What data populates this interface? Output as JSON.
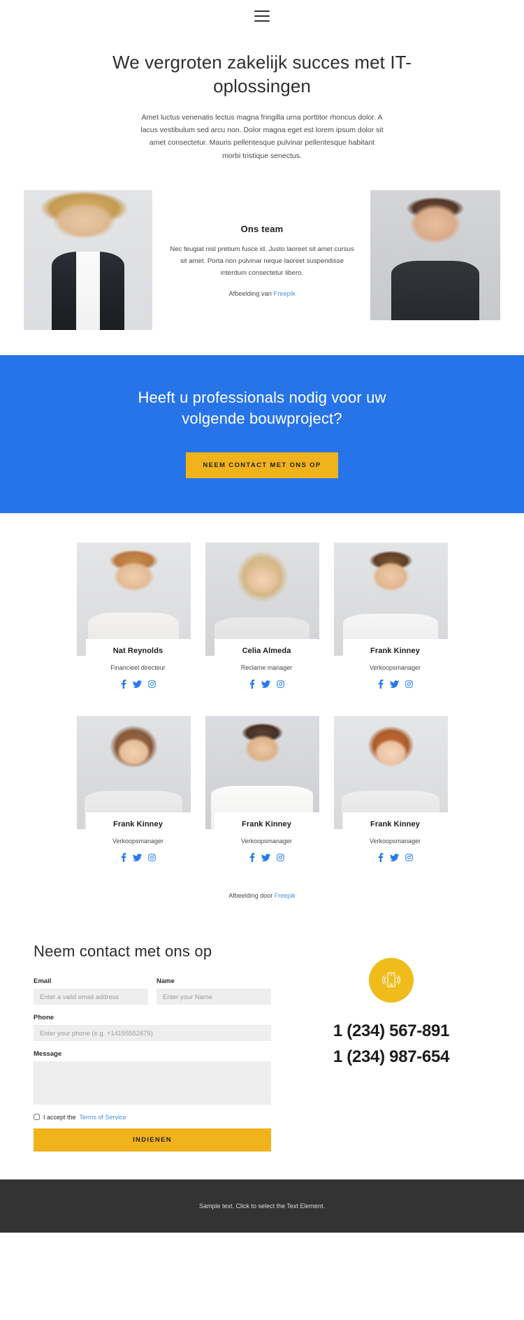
{
  "header": {
    "menu_icon": "hamburger-menu-icon"
  },
  "hero": {
    "title": "We vergroten zakelijk succes met IT-oplossingen",
    "description": "Amet luctus venenatis lectus magna fringilla urna porttitor rhoncus dolor. A lacus vestibulum sed arcu non. Dolor magna eget est lorem ipsum dolor sit amet consectetur. Mauris pellentesque pulvinar pellentesque habitant morbi tristique senectus."
  },
  "team_intro": {
    "heading": "Ons team",
    "body": "Nec feugiat nisl pretium fusce id. Justo laoreet sit amet cursus sit amet. Porta non pulvinar neque laoreet suspendisse interdum consectetur libero.",
    "credit_prefix": "Afbeelding van ",
    "credit_link": "Freepik",
    "photo_left_alt": "blonde-businesswoman-photo",
    "photo_right_alt": "young-man-black-shirt-photo"
  },
  "cta": {
    "heading": "Heeft u professionals nodig voor uw volgende bouwproject?",
    "button": "NEEM CONTACT MET ONS OP",
    "bg_color": "#2774e8",
    "button_color": "#f0b31b"
  },
  "team": {
    "members": [
      {
        "name": "Nat Reynolds",
        "role": "Financieel directeur",
        "photo": "bearded-man-glasses-photo"
      },
      {
        "name": "Celia Almeda",
        "role": "Reclame manager",
        "photo": "blonde-woman-photo"
      },
      {
        "name": "Frank Kinney",
        "role": "Verkoopsmanager",
        "photo": "young-man-white-shirt-photo"
      },
      {
        "name": "Frank Kinney",
        "role": "Verkoopsmanager",
        "photo": "woman-bob-haircut-photo"
      },
      {
        "name": "Frank Kinney",
        "role": "Verkoopsmanager",
        "photo": "bearded-man-white-shirt-photo"
      },
      {
        "name": "Frank Kinney",
        "role": "Verkoopsmanager",
        "photo": "redhead-woman-photo"
      }
    ],
    "social_icons": [
      "facebook-icon",
      "twitter-icon",
      "instagram-icon"
    ],
    "credit_prefix": "Afbeelding door ",
    "credit_link": "Freepik"
  },
  "contact": {
    "heading": "Neem contact met ons op",
    "fields": {
      "email": {
        "label": "Email",
        "placeholder": "Enter a valid email address",
        "value": ""
      },
      "name": {
        "label": "Name",
        "placeholder": "Enter your Name",
        "value": ""
      },
      "phone": {
        "label": "Phone",
        "placeholder": "Enter your phone (e.g. +14155552675)",
        "value": ""
      },
      "message": {
        "label": "Message",
        "placeholder": "",
        "value": ""
      }
    },
    "accept_prefix": "I accept the ",
    "accept_link": "Terms of Service",
    "submit": "INDIENEN",
    "phone_icon": "mobile-phone-ringing-icon",
    "phone_numbers": [
      "1 (234) 567-891",
      "1 (234) 987-654"
    ]
  },
  "footer": {
    "text": "Sample text. Click to select the Text Element."
  }
}
